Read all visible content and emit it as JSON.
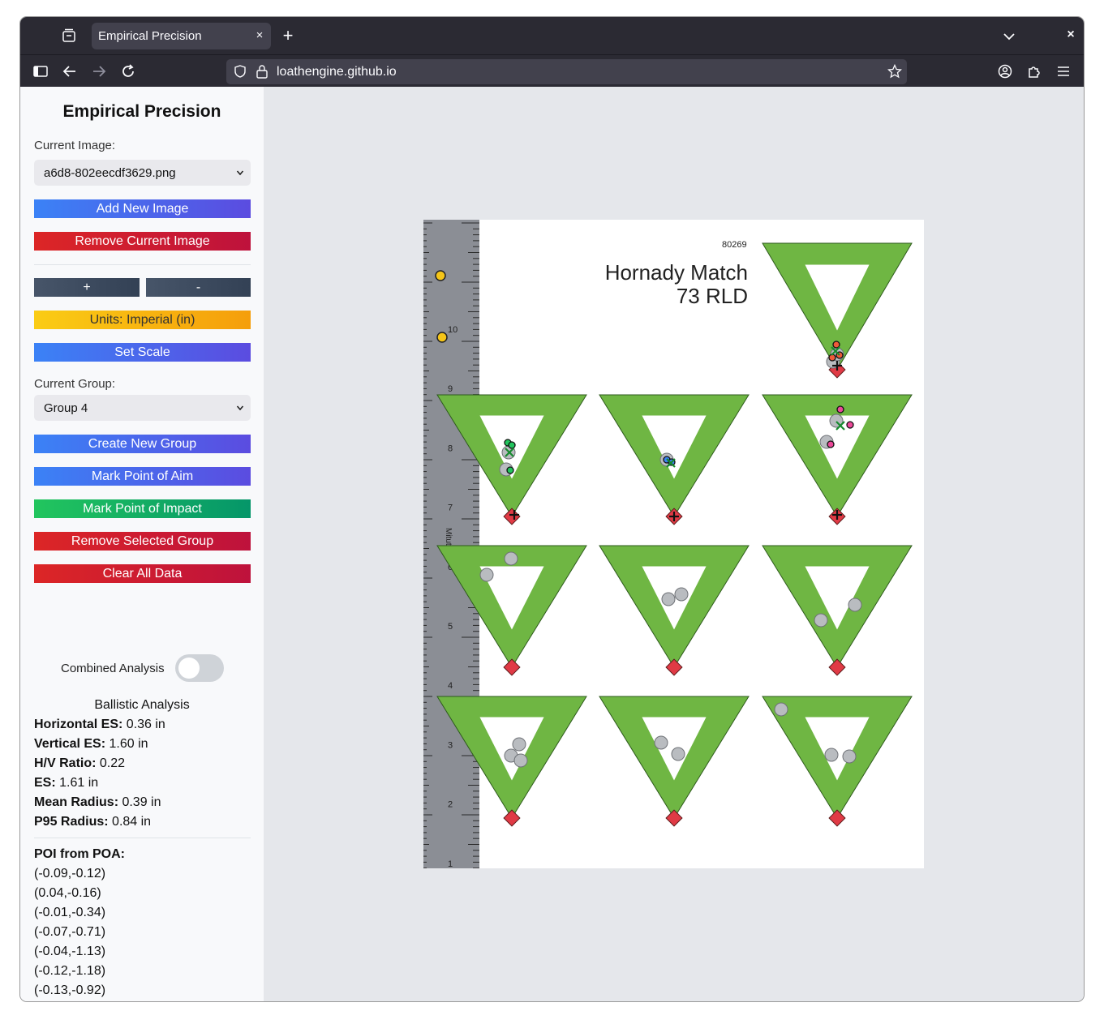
{
  "browser": {
    "tab_title": "Empirical Precision",
    "tab_close": "×",
    "new_tab": "+",
    "window_close": "×",
    "url": "loathengine.github.io"
  },
  "sidebar": {
    "title": "Empirical Precision",
    "current_image_label": "Current Image:",
    "current_image_value": "a6d8-802eecdf3629.png",
    "add_image": "Add New Image",
    "remove_image": "Remove Current Image",
    "zoom_in": "+",
    "zoom_out": "-",
    "units": "Units: Imperial (in)",
    "set_scale": "Set Scale",
    "current_group_label": "Current Group:",
    "current_group_value": "Group 4",
    "create_group": "Create New Group",
    "mark_aim": "Mark Point of Aim",
    "mark_impact": "Mark Point of Impact",
    "remove_group": "Remove Selected Group",
    "clear_all": "Clear All Data",
    "combined_label": "Combined Analysis",
    "combined_on": false
  },
  "analysis": {
    "title": "Ballistic Analysis",
    "stats": [
      {
        "label": "Horizontal ES:",
        "value": " 0.36 in"
      },
      {
        "label": "Vertical ES:",
        "value": " 1.60 in"
      },
      {
        "label": "H/V Ratio:",
        "value": " 0.22"
      },
      {
        "label": "ES:",
        "value": " 1.61 in"
      },
      {
        "label": "Mean Radius:",
        "value": " 0.39 in"
      },
      {
        "label": "P95 Radius:",
        "value": " 0.84 in"
      }
    ],
    "poi_title": "POI from POA:",
    "poi": [
      "(-0.09,-0.12)",
      "(0.04,-0.16)",
      "(-0.01,-0.34)",
      "(-0.07,-0.71)",
      "(-0.04,-1.13)",
      "(-0.12,-1.18)",
      "(-0.13,-0.92)"
    ]
  },
  "target": {
    "code": "80269",
    "brand_line1": "Hornady Match",
    "brand_line2": "73 RLD",
    "ruler_numbers": [
      "1",
      "2",
      "3",
      "4",
      "5",
      "6",
      "7",
      "8",
      "9",
      "10"
    ],
    "ruler_brand": "Mitutoyo"
  },
  "colors": {
    "target_green": "#6fb643",
    "diamond_red": "#e03a45",
    "scale_marker": "#f5c518",
    "group1_marker": "#f05a3a",
    "group2_marker": "#22c55e",
    "group3_marker": "#3b82f6",
    "group4_marker": "#ec4899"
  }
}
